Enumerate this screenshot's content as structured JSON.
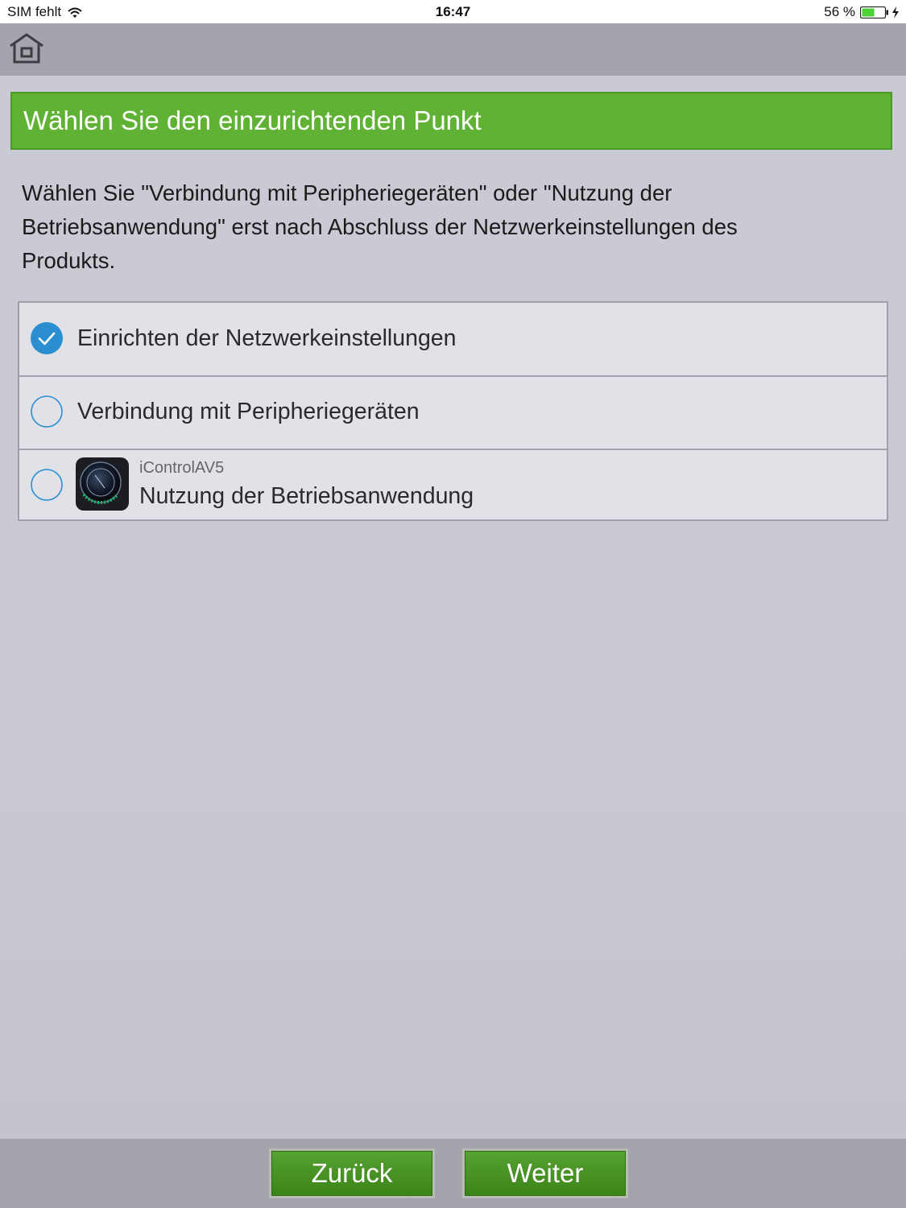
{
  "status_bar": {
    "carrier": "SIM fehlt",
    "time": "16:47",
    "battery_percent": "56 %",
    "battery_level": 0.56,
    "icons": [
      "wifi-icon",
      "battery-icon",
      "charging-bolt-icon"
    ]
  },
  "toolbar": {
    "home_icon": "home-icon"
  },
  "header": {
    "title": "Wählen Sie den einzurichtenden Punkt",
    "color": "#5fb234"
  },
  "description": "Wählen Sie \"Verbindung mit Peripheriegeräten\" oder \"Nutzung der Betriebsanwendung\" erst nach Abschluss der Netzwerkeinstellungen des Produkts.",
  "options": [
    {
      "label": "Einrichten der Netzwerkeinstellungen",
      "selected": true
    },
    {
      "label": "Verbindung mit Peripheriegeräten",
      "selected": false
    },
    {
      "app_name": "iControlAV5",
      "label": "Nutzung der Betriebsanwendung",
      "selected": false,
      "icon": "icontrolav5-app-icon"
    }
  ],
  "accent_color": "#2b8ed0",
  "footer": {
    "back_label": "Zurück",
    "next_label": "Weiter"
  }
}
